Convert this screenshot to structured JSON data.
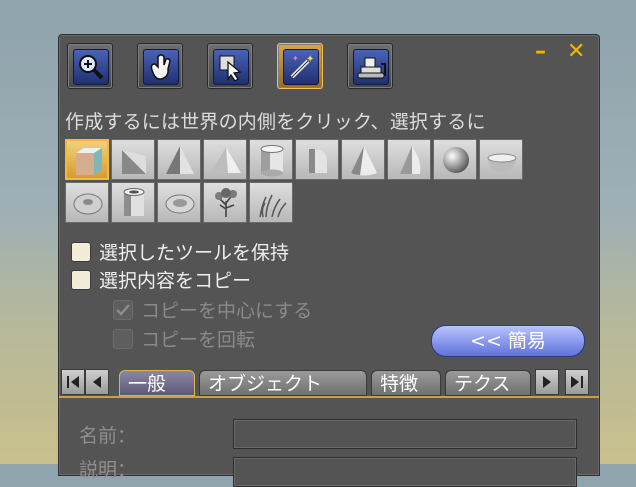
{
  "toolbar": {
    "tools": [
      {
        "name": "focus",
        "icon": "zoom-icon",
        "active": false
      },
      {
        "name": "move",
        "icon": "hand-icon",
        "active": false
      },
      {
        "name": "edit",
        "icon": "select-pointer-icon",
        "active": false
      },
      {
        "name": "create",
        "icon": "magic-wand-icon",
        "active": true
      },
      {
        "name": "land",
        "icon": "bulldozer-icon",
        "active": false
      }
    ],
    "minimize_label": "–",
    "close_label": "✕"
  },
  "hint": "作成するには世界の内側をクリック、選択するに",
  "shapes": [
    {
      "icon": "cube-icon",
      "selected": true
    },
    {
      "icon": "prism-icon",
      "selected": false
    },
    {
      "icon": "pyramid-icon",
      "selected": false
    },
    {
      "icon": "tetrahedron-icon",
      "selected": false
    },
    {
      "icon": "cylinder-icon",
      "selected": false
    },
    {
      "icon": "half-cylinder-icon",
      "selected": false
    },
    {
      "icon": "cone-icon",
      "selected": false
    },
    {
      "icon": "half-cone-icon",
      "selected": false
    },
    {
      "icon": "sphere-icon",
      "selected": false
    },
    {
      "icon": "hemisphere-icon",
      "selected": false
    },
    {
      "icon": "torus-icon",
      "selected": false
    },
    {
      "icon": "tube-icon",
      "selected": false
    },
    {
      "icon": "ring-icon",
      "selected": false
    },
    {
      "icon": "tree-icon",
      "selected": false
    },
    {
      "icon": "grass-icon",
      "selected": false
    }
  ],
  "options": {
    "keep_tool": {
      "label": "選択したツールを保持",
      "checked": false
    },
    "copy_selection": {
      "label": "選択内容をコピー",
      "checked": false
    },
    "center_copy": {
      "label": "コピーを中心にする",
      "checked": true,
      "disabled": true
    },
    "rotate_copy": {
      "label": "コピーを回転",
      "checked": false,
      "disabled": true
    }
  },
  "simple_button": "<< 簡易",
  "tabs": [
    "一般",
    "オブジェクト",
    "特徴",
    "テクス"
  ],
  "active_tab": "一般",
  "fields": {
    "name_label": "名前：",
    "desc_label": "説明："
  }
}
